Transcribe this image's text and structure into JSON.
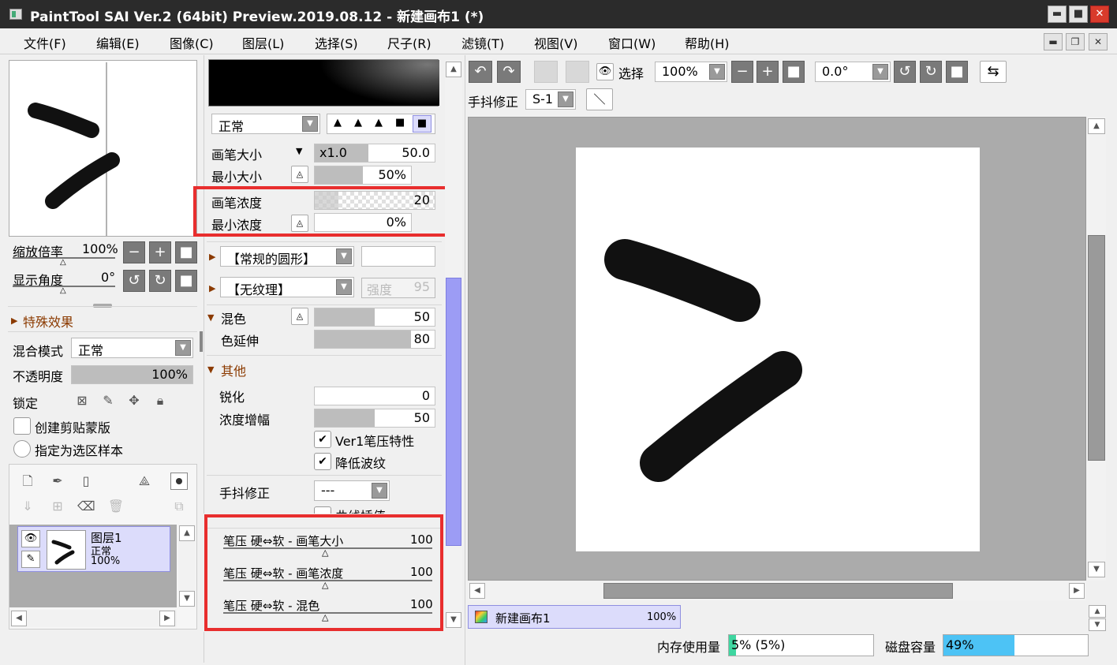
{
  "window": {
    "title": "PaintTool SAI Ver.2 (64bit) Preview.2019.08.12 - 新建画布1 (*)",
    "min": "▬",
    "max": "■",
    "close": "✕",
    "mdi_min": "▬",
    "mdi_restore": "❐",
    "mdi_close": "✕"
  },
  "menu": [
    "文件(F)",
    "编辑(E)",
    "图像(C)",
    "图层(L)",
    "选择(S)",
    "尺子(R)",
    "滤镜(T)",
    "视图(V)",
    "窗口(W)",
    "帮助(H)"
  ],
  "navigator": {
    "zoom_label": "缩放倍率",
    "zoom_value": "100%",
    "angle_label": "显示角度",
    "angle_value": "0°",
    "minus": "−",
    "plus": "+",
    "reset": "■",
    "rot_ccw": "↺",
    "rot_cw": "↻"
  },
  "effects": {
    "header": "特殊效果"
  },
  "layer_props": {
    "blend_label": "混合模式",
    "blend_value": "正常",
    "opacity_label": "不透明度",
    "opacity_value": "100%",
    "opacity_fraction": 1.0,
    "lock_label": "锁定",
    "clip_label": "创建剪贴蒙版",
    "select_sample_label": "指定为选区样本"
  },
  "layers": [
    {
      "name": "图层1",
      "mode": "正常",
      "opacity": "100%"
    }
  ],
  "brush": {
    "mode_value": "正常",
    "size_label": "画笔大小",
    "size_multiplier": "x1.0",
    "size_value": "50.0",
    "size_fraction": 0.45,
    "min_size_label": "最小大小",
    "min_size_value": "50%",
    "min_size_fraction": 0.5,
    "density_label": "画笔浓度",
    "density_value": "20",
    "density_fraction": 0.2,
    "min_density_label": "最小浓度",
    "min_density_value": "0%",
    "min_density_fraction": 0.0,
    "shape_value": "【常规的圆形】",
    "texture_value": "【无纹理】",
    "texture_strength_label": "强度",
    "texture_strength_value": "95",
    "blend_label": "混色",
    "blend_value": "50",
    "blend_fraction": 0.5,
    "dilution_label": "色延伸",
    "dilution_value": "80",
    "dilution_fraction": 0.8,
    "other_header": "其他",
    "sharpen_label": "锐化",
    "sharpen_value": "0",
    "sharpen_fraction": 0.0,
    "density_gain_label": "浓度增幅",
    "density_gain_value": "50",
    "density_gain_fraction": 0.5,
    "ver1_label": "Ver1笔压特性",
    "reduce_ripple_label": "降低波纹",
    "stabilizer_label": "手抖修正",
    "stabilizer_value": "---",
    "curve_interp_label": "曲线插值",
    "pressure_size_label": "笔压 硬⇔软 - 画笔大小",
    "pressure_size_value": "100",
    "pressure_density_label": "笔压 硬⇔软 - 画笔浓度",
    "pressure_density_value": "100",
    "pressure_blend_label": "笔压 硬⇔软 - 混色",
    "pressure_blend_value": "100"
  },
  "toolbar": {
    "select_label": "选择",
    "zoom_value": "100%",
    "angle_value": "0.0°",
    "stabilizer_label": "手抖修正",
    "stabilizer_value": "S-1",
    "flip_icon": "⇆",
    "undo_icon": "↶",
    "redo_icon": "↷",
    "pen_icon": "＼"
  },
  "canvas_tab": {
    "name": "新建画布1",
    "zoom": "100%"
  },
  "status": {
    "memory_label": "内存使用量",
    "memory_value": "5% (5%)",
    "memory_fraction": 0.05,
    "disk_label": "磁盘容量",
    "disk_value": "49%",
    "disk_fraction": 0.49
  },
  "colors": {
    "titlebar": "#2b2b2b",
    "accent_scroll": "#9c9cf5",
    "highlight_box": "#e82e2e",
    "disk_bar": "#4dc3f5",
    "memory_bar": "#3fd6a0"
  }
}
